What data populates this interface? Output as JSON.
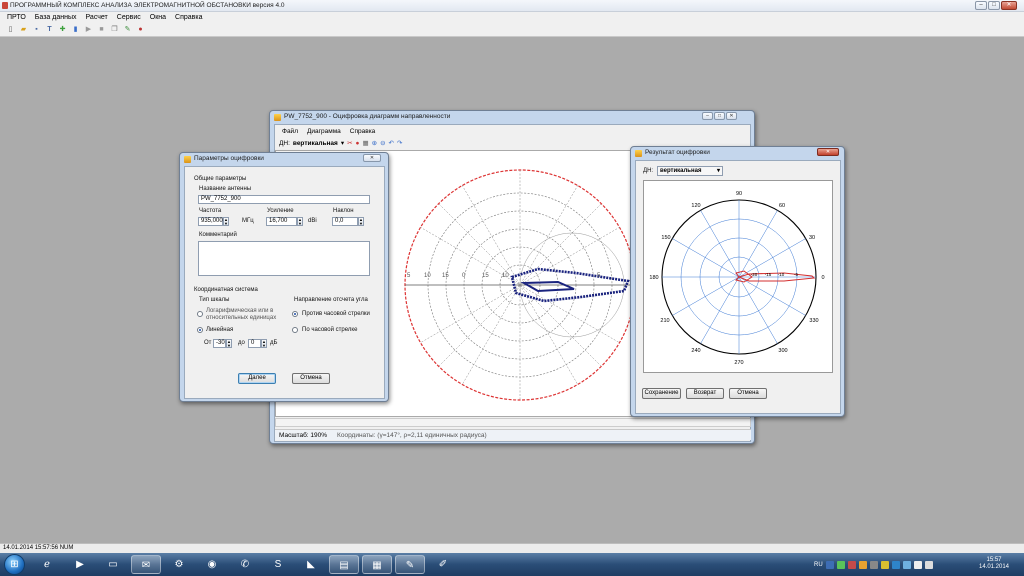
{
  "app": {
    "title": "ПРОГРАММНЫЙ КОМПЛЕКС АНАЛИЗА ЭЛЕКТРОМАГНИТНОЙ ОБСТАНОВКИ версия 4.0",
    "menu": [
      "ПРТО",
      "База данных",
      "Расчет",
      "Сервис",
      "Окна",
      "Справка"
    ],
    "statusbar": "14.01.2014 15:57:56  NUM"
  },
  "digitizer": {
    "title": "PW_7752_900 - Оцифровка диаграмм направленности",
    "menu": [
      "Файл",
      "Диаграмма",
      "Справка"
    ],
    "dn_label": "ДН:",
    "dn_value": "вертикальная",
    "scale": "Масштаб: 190%",
    "coords": "Координаты: (γ=147°, ρ=2,11 единичных радиуса)",
    "image_ticks": [
      "5",
      "10",
      "15",
      "0",
      "15",
      "10",
      "5"
    ]
  },
  "params": {
    "title": "Параметры оцифровки",
    "general": "Общие параметры",
    "antenna_label": "Название антенны",
    "antenna_value": "PW_7752_900",
    "freq_label": "Частота",
    "freq_value": "935,000",
    "freq_unit": "МГц",
    "gain_label": "Усиление",
    "gain_value": "16,700",
    "gain_unit": "dBi",
    "tilt_label": "Наклон",
    "tilt_value": "0,0",
    "comment_label": "Комментарий",
    "coord_system": "Координатная система",
    "scale_type": "Тип шкалы",
    "log_option": "Логарифмическая или в относительных единицах",
    "linear_option": "Линейная",
    "from_label": "От",
    "from_value": "-30",
    "to_label": "до",
    "to_value": "0",
    "db_unit": "дБ",
    "direction": "Направление отсчета угла",
    "ccw": "Против часовой стрелки",
    "cw": "По часовой стрелке",
    "next": "Далее",
    "cancel": "Отмена"
  },
  "result": {
    "title": "Результат оцифровки",
    "dn_label": "ДН:",
    "dn_value": "вертикальная",
    "angles": [
      "90",
      "60",
      "30",
      "0",
      "330",
      "300",
      "270",
      "240",
      "210",
      "180",
      "150",
      "120"
    ],
    "radial_ticks": [
      "-20",
      "-15",
      "-10",
      "-5"
    ],
    "save": "Сохранение",
    "back": "Возврат",
    "cancel": "Отмена"
  },
  "taskbar": {
    "lang": "RU",
    "time": "15:57",
    "date": "14.01.2014"
  },
  "colors": {
    "accent": "#1e4fa8",
    "pattern_blue": "#1a237e",
    "pattern_red": "#d32f2f"
  }
}
